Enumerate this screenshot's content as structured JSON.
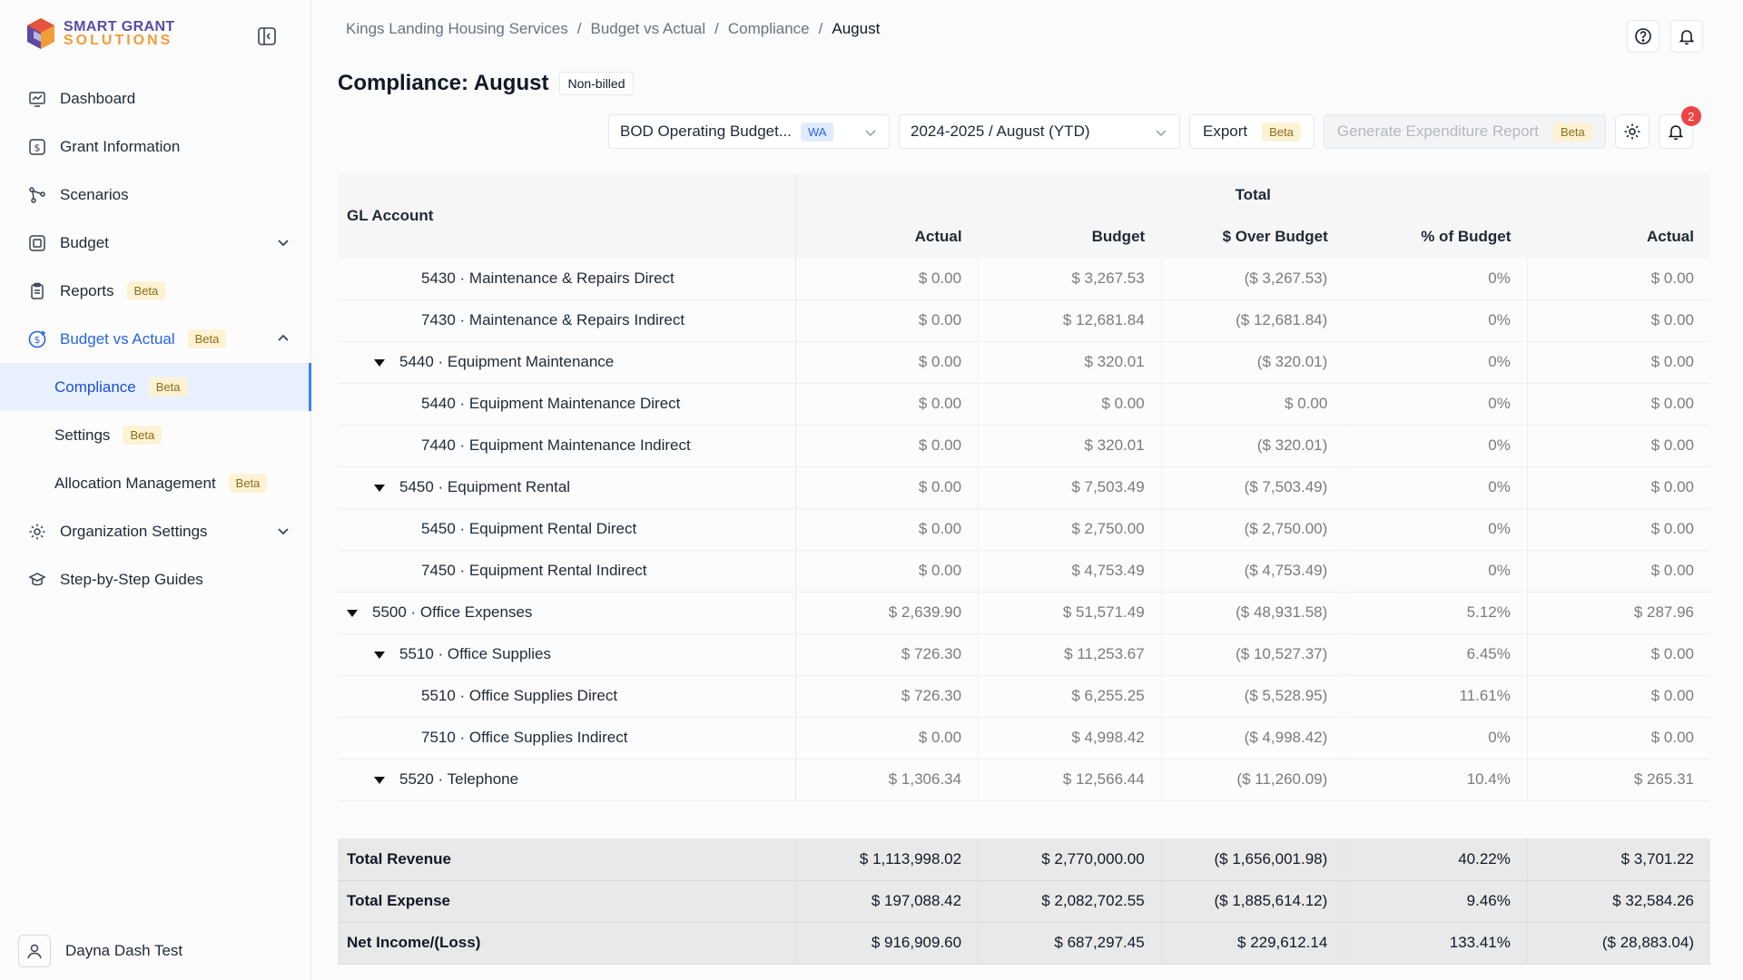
{
  "app": {
    "logo_line1": "SMART GRANT",
    "logo_line2": "SOLUTIONS"
  },
  "sidebar": {
    "items": [
      {
        "label": "Dashboard",
        "icon": "dashboard-icon"
      },
      {
        "label": "Grant Information",
        "icon": "dollar-icon"
      },
      {
        "label": "Scenarios",
        "icon": "scenarios-icon"
      },
      {
        "label": "Budget",
        "icon": "budget-icon"
      },
      {
        "label": "Reports",
        "icon": "reports-icon",
        "badge": "Beta"
      },
      {
        "label": "Budget vs Actual",
        "icon": "budget-vs-actual-icon",
        "badge": "Beta"
      }
    ],
    "sub_items": [
      {
        "label": "Compliance",
        "badge": "Beta"
      },
      {
        "label": "Settings",
        "badge": "Beta"
      },
      {
        "label": "Allocation Management",
        "badge": "Beta"
      }
    ],
    "bottom_items": [
      {
        "label": "Organization Settings",
        "icon": "gear-icon"
      },
      {
        "label": "Step-by-Step Guides",
        "icon": "guides-icon"
      }
    ],
    "user_name": "Dayna Dash Test"
  },
  "breadcrumb": [
    "Kings Landing Housing Services",
    "Budget vs Actual",
    "Compliance",
    "August"
  ],
  "page": {
    "title": "Compliance: August",
    "tag": "Non-billed"
  },
  "toolbar": {
    "budget_select": "BOD Operating Budget...",
    "budget_badge": "WA",
    "period_select": "2024-2025 / August (YTD)",
    "export_label": "Export",
    "export_badge": "Beta",
    "generate_label": "Generate Expenditure Report",
    "generate_badge": "Beta",
    "notification_count": "2"
  },
  "table": {
    "group_header": "Total",
    "account_header": "GL Account",
    "columns": [
      "Actual",
      "Budget",
      "$ Over Budget",
      "% of Budget",
      "Actual"
    ],
    "rows": [
      {
        "indent": 2,
        "caret": false,
        "name": "5430 · Maintenance & Repairs Direct",
        "values": [
          "$ 0.00",
          "$ 3,267.53",
          "($ 3,267.53)",
          "0%",
          "$ 0.00"
        ]
      },
      {
        "indent": 2,
        "caret": false,
        "name": "7430 · Maintenance & Repairs Indirect",
        "values": [
          "$ 0.00",
          "$ 12,681.84",
          "($ 12,681.84)",
          "0%",
          "$ 0.00"
        ]
      },
      {
        "indent": 1,
        "caret": true,
        "name": "5440 · Equipment Maintenance",
        "values": [
          "$ 0.00",
          "$ 320.01",
          "($ 320.01)",
          "0%",
          "$ 0.00"
        ]
      },
      {
        "indent": 2,
        "caret": false,
        "name": "5440 · Equipment Maintenance Direct",
        "values": [
          "$ 0.00",
          "$ 0.00",
          "$ 0.00",
          "0%",
          "$ 0.00"
        ]
      },
      {
        "indent": 2,
        "caret": false,
        "name": "7440 · Equipment Maintenance Indirect",
        "values": [
          "$ 0.00",
          "$ 320.01",
          "($ 320.01)",
          "0%",
          "$ 0.00"
        ]
      },
      {
        "indent": 1,
        "caret": true,
        "name": "5450 · Equipment Rental",
        "values": [
          "$ 0.00",
          "$ 7,503.49",
          "($ 7,503.49)",
          "0%",
          "$ 0.00"
        ]
      },
      {
        "indent": 2,
        "caret": false,
        "name": "5450 · Equipment Rental Direct",
        "values": [
          "$ 0.00",
          "$ 2,750.00",
          "($ 2,750.00)",
          "0%",
          "$ 0.00"
        ]
      },
      {
        "indent": 2,
        "caret": false,
        "name": "7450 · Equipment Rental Indirect",
        "values": [
          "$ 0.00",
          "$ 4,753.49",
          "($ 4,753.49)",
          "0%",
          "$ 0.00"
        ]
      },
      {
        "indent": 0,
        "caret": true,
        "name": "5500 · Office Expenses",
        "values": [
          "$ 2,639.90",
          "$ 51,571.49",
          "($ 48,931.58)",
          "5.12%",
          "$ 287.96"
        ]
      },
      {
        "indent": 1,
        "caret": true,
        "name": "5510 · Office Supplies",
        "values": [
          "$ 726.30",
          "$ 11,253.67",
          "($ 10,527.37)",
          "6.45%",
          "$ 0.00"
        ]
      },
      {
        "indent": 2,
        "caret": false,
        "name": "5510 · Office Supplies Direct",
        "values": [
          "$ 726.30",
          "$ 6,255.25",
          "($ 5,528.95)",
          "11.61%",
          "$ 0.00"
        ]
      },
      {
        "indent": 2,
        "caret": false,
        "name": "7510 · Office Supplies Indirect",
        "values": [
          "$ 0.00",
          "$ 4,998.42",
          "($ 4,998.42)",
          "0%",
          "$ 0.00"
        ]
      },
      {
        "indent": 1,
        "caret": true,
        "name": "5520 · Telephone",
        "values": [
          "$ 1,306.34",
          "$ 12,566.44",
          "($ 11,260.09)",
          "10.4%",
          "$ 265.31"
        ]
      }
    ],
    "totals": [
      {
        "name": "Total Revenue",
        "values": [
          "$ 1,113,998.02",
          "$ 2,770,000.00",
          "($ 1,656,001.98)",
          "40.22%",
          "$ 3,701.22"
        ]
      },
      {
        "name": "Total Expense",
        "values": [
          "$ 197,088.42",
          "$ 2,082,702.55",
          "($ 1,885,614.12)",
          "9.46%",
          "$ 32,584.26"
        ]
      },
      {
        "name": "Net Income/(Loss)",
        "values": [
          "$ 916,909.60",
          "$ 687,297.45",
          "$ 229,612.14",
          "133.41%",
          "($ 28,883.04)"
        ]
      }
    ]
  },
  "colors": {
    "accent": "#2563eb",
    "brand_purple": "#5b4aa8",
    "brand_orange": "#f29c38",
    "beta_bg": "#fdf3d4",
    "notification": "#ef4444"
  }
}
